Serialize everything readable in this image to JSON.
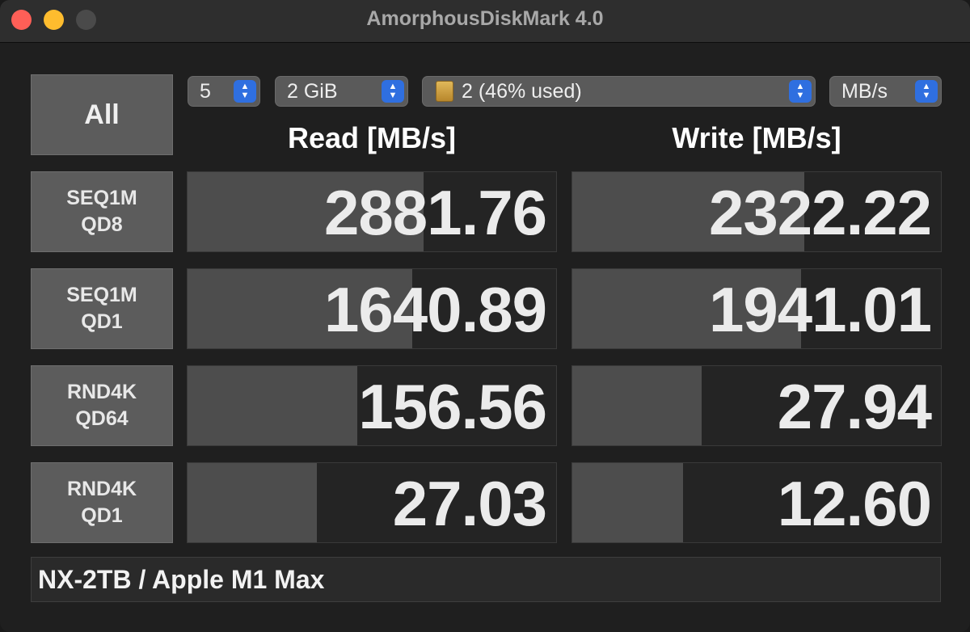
{
  "window": {
    "title": "AmorphousDiskMark 4.0"
  },
  "controls": {
    "all_label": "All",
    "count": "5",
    "size": "2 GiB",
    "drive": "2 (46% used)",
    "unit": "MB/s"
  },
  "columns": {
    "read": "Read [MB/s]",
    "write": "Write [MB/s]"
  },
  "rows": [
    {
      "label1": "SEQ1M",
      "label2": "QD8",
      "read": "2881.76",
      "write": "2322.22",
      "read_fill": 0.64,
      "write_fill": 0.63
    },
    {
      "label1": "SEQ1M",
      "label2": "QD1",
      "read": "1640.89",
      "write": "1941.01",
      "read_fill": 0.61,
      "write_fill": 0.62
    },
    {
      "label1": "RND4K",
      "label2": "QD64",
      "read": "156.56",
      "write": "27.94",
      "read_fill": 0.46,
      "write_fill": 0.35
    },
    {
      "label1": "RND4K",
      "label2": "QD1",
      "read": "27.03",
      "write": "12.60",
      "read_fill": 0.35,
      "write_fill": 0.3
    }
  ],
  "footer": {
    "comment": "NX-2TB / Apple M1 Max"
  },
  "icons": {
    "drive": "external-drive-icon",
    "stepper": "up-down-stepper-icon"
  },
  "colors": {
    "close": "#ff5f57",
    "minimize": "#febc2e",
    "accent": "#2f6fe0"
  }
}
